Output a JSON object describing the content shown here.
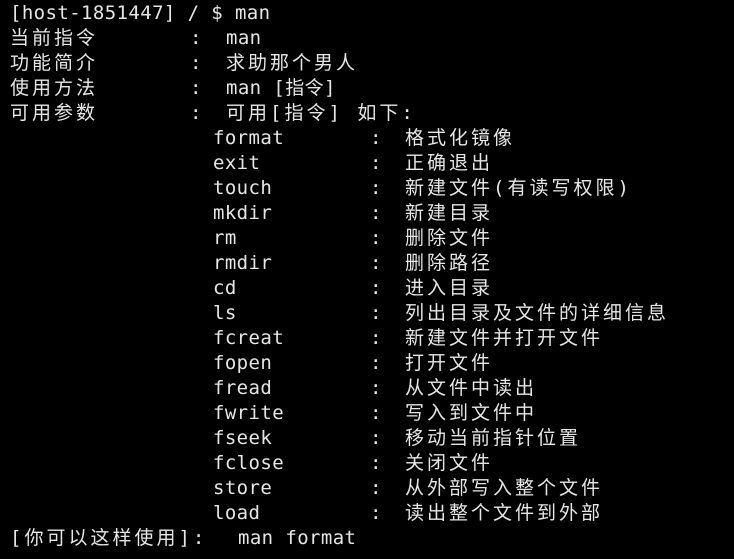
{
  "prompt": "[host-1851447] / $ man",
  "header_rows": [
    {
      "label": "当前指令",
      "colon": ":",
      "value": "man"
    },
    {
      "label": "功能简介",
      "colon": ":",
      "value": "求助那个男人"
    },
    {
      "label": "使用方法",
      "colon": ":",
      "value": "man [指令]"
    },
    {
      "label": "可用参数",
      "colon": ":",
      "value": "可用[指令] 如下:"
    }
  ],
  "commands": [
    {
      "cmd": "format",
      "colon": ":",
      "desc": "格式化镜像"
    },
    {
      "cmd": "exit",
      "colon": ":",
      "desc": "正确退出"
    },
    {
      "cmd": "touch",
      "colon": ":",
      "desc": "新建文件(有读写权限)"
    },
    {
      "cmd": "mkdir",
      "colon": ":",
      "desc": "新建目录"
    },
    {
      "cmd": "rm",
      "colon": ":",
      "desc": "删除文件"
    },
    {
      "cmd": "rmdir",
      "colon": ":",
      "desc": "删除路径"
    },
    {
      "cmd": "cd",
      "colon": ":",
      "desc": "进入目录"
    },
    {
      "cmd": "ls",
      "colon": ":",
      "desc": "列出目录及文件的详细信息"
    },
    {
      "cmd": "fcreat",
      "colon": ":",
      "desc": "新建文件并打开文件"
    },
    {
      "cmd": "fopen",
      "colon": ":",
      "desc": "打开文件"
    },
    {
      "cmd": "fread",
      "colon": ":",
      "desc": "从文件中读出"
    },
    {
      "cmd": "fwrite",
      "colon": ":",
      "desc": "写入到文件中"
    },
    {
      "cmd": "fseek",
      "colon": ":",
      "desc": "移动当前指针位置"
    },
    {
      "cmd": "fclose",
      "colon": ":",
      "desc": "关闭文件"
    },
    {
      "cmd": "store",
      "colon": ":",
      "desc": "从外部写入整个文件"
    },
    {
      "cmd": "load",
      "colon": ":",
      "desc": "读出整个文件到外部"
    }
  ],
  "example": {
    "label": "[你可以这样使用]:",
    "value": "man format"
  },
  "colors": {
    "background": "#000000",
    "text": "#e6e6e6"
  }
}
